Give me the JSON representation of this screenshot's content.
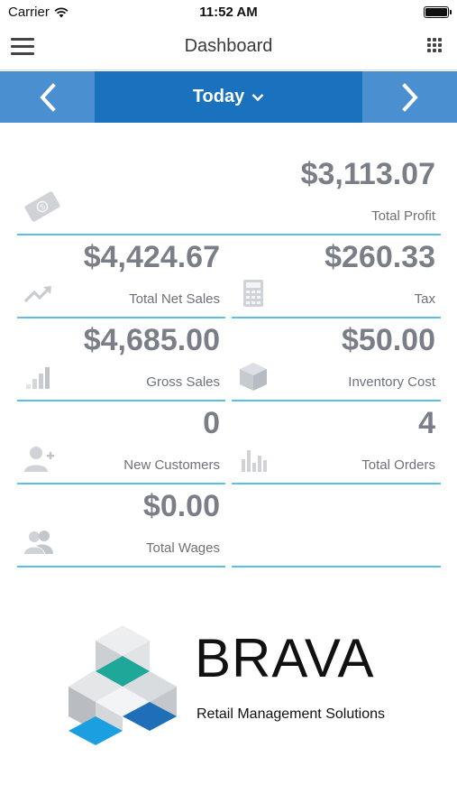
{
  "status_bar": {
    "carrier": "Carrier",
    "time": "11:52 AM"
  },
  "nav": {
    "title": "Dashboard"
  },
  "date_bar": {
    "period": "Today"
  },
  "metrics": {
    "total_profit": {
      "value": "$3,113.07",
      "label": "Total Profit",
      "icon": "money-icon"
    },
    "total_net_sales": {
      "value": "$4,424.67",
      "label": "Total Net Sales",
      "icon": "trend-up-icon"
    },
    "tax": {
      "value": "$260.33",
      "label": "Tax",
      "icon": "calculator-icon"
    },
    "gross_sales": {
      "value": "$4,685.00",
      "label": "Gross Sales",
      "icon": "bar-signal-icon"
    },
    "inventory_cost": {
      "value": "$50.00",
      "label": "Inventory Cost",
      "icon": "box-icon"
    },
    "new_customers": {
      "value": "0",
      "label": "New Customers",
      "icon": "add-user-icon"
    },
    "total_orders": {
      "value": "4",
      "label": "Total Orders",
      "icon": "bar-chart-icon"
    },
    "total_wages": {
      "value": "$0.00",
      "label": "Total Wages",
      "icon": "users-icon"
    }
  },
  "logo": {
    "brand": "BRAVA",
    "tagline": "Retail Management Solutions"
  },
  "colors": {
    "accent": "#1a72bf",
    "accent_light": "#4a8fd0",
    "divider": "#5bbfe8",
    "value_text": "#7a7f87"
  }
}
